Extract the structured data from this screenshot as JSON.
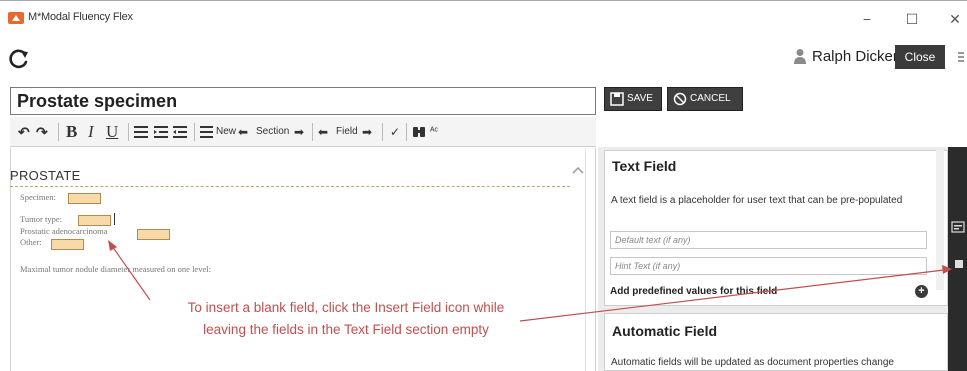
{
  "window": {
    "title": "M*Modal Fluency Flex",
    "minimize_glyph": "−",
    "maximize_glyph": "☐",
    "close_glyph": "✕"
  },
  "header": {
    "user_name": "Ralph Dickerson ▾",
    "close_label": "Close"
  },
  "document": {
    "title": "Prostate specimen"
  },
  "toolbar": {
    "undo": "↶",
    "redo": "↷",
    "bold": "B",
    "italic": "I",
    "underline": "U",
    "new_label": "New",
    "section_label": "Section",
    "field_label": "Field",
    "section_prev": "⬅",
    "section_next": "➡",
    "field_prev": "⬅",
    "field_next": "➡",
    "spell_glyph": "✓",
    "find_glyph": "⌕",
    "replace_glyph": "ᴬᶜ"
  },
  "editor": {
    "section_heading": "PROSTATE",
    "lines": [
      {
        "label": "Specimen:"
      },
      {
        "label": "Tumor type:"
      },
      {
        "label": "Prostatic adenocarcinoma"
      },
      {
        "label": "Other:"
      },
      {
        "label": "Maximal tumor nodule diameter measured on one level:"
      }
    ]
  },
  "actions": {
    "save_label": "SAVE",
    "cancel_label": "CANCEL"
  },
  "text_field_panel": {
    "title": "Text Field",
    "description": "A text field is a placeholder for user text that can be pre-populated",
    "default_text_placeholder": "Default text (if any)",
    "hint_text_placeholder": "Hint Text (if any)",
    "predefined_label": "Add predefined values for this field",
    "add_glyph": "+"
  },
  "automatic_field_panel": {
    "title": "Automatic Field",
    "description": "Automatic fields will be updated as document properties change"
  },
  "annotation": {
    "line1": "To insert a blank field, click the Insert Field icon while",
    "line2": "leaving the fields in the Text Field section empty"
  },
  "colors": {
    "annotation": "#c0504d",
    "field_fill": "#f8d9a8",
    "dark_button": "#3f3f3f",
    "side_strip": "#2b2b2b"
  }
}
